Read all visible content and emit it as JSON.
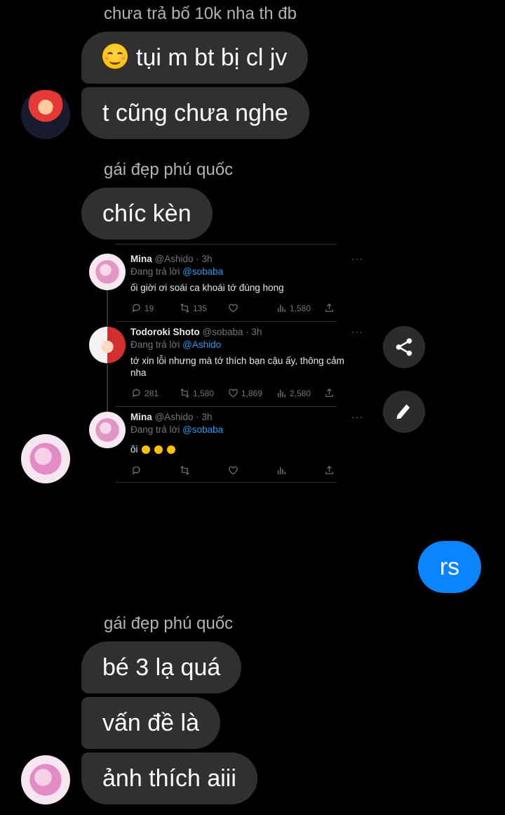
{
  "messages": {
    "group1": {
      "sender": "chưa trả bố 10k nha th đb",
      "bubble1": "tụi m bt bị cl jv",
      "bubble2": "t cũng chưa nghe"
    },
    "group2": {
      "sender": "gái đẹp phú quốc",
      "bubble1": "chíc kèn"
    },
    "outgoing": {
      "text": "rs"
    },
    "group3": {
      "sender": "gái đẹp phú quốc",
      "bubble1": "bé 3 lạ quá",
      "bubble2": "vấn đề là",
      "bubble3": "ảnh thích aiii"
    }
  },
  "tweets": [
    {
      "name": "Mina",
      "handle": "@Ashido · 3h",
      "reply_prefix": "Đang trả lời",
      "reply_to": "@sobaba",
      "text": "ối giời ơi soái ca khoái tớ đúng hong",
      "replies": "19",
      "retweets": "135",
      "likes": "",
      "views": "1,580"
    },
    {
      "name": "Todoroki Shoto",
      "handle": "@sobaba · 3h",
      "reply_prefix": "Đang trả lời",
      "reply_to": "@Ashido",
      "text": "tớ xin lỗi nhưng mà tớ thích bạn cậu ấy, thông cảm nha",
      "replies": "281",
      "retweets": "1,580",
      "likes": "1,869",
      "views": "2,580"
    },
    {
      "name": "Mina",
      "handle": "@Ashido · 3h",
      "reply_prefix": "Đang trả lời",
      "reply_to": "@sobaba",
      "text": "ôi",
      "replies": "",
      "retweets": "",
      "likes": "",
      "views": ""
    }
  ],
  "icons": {
    "share": "share-icon",
    "edit": "pencil-icon"
  },
  "colors": {
    "background": "#000000",
    "incoming_bubble": "#303030",
    "outgoing_bubble": "#0a84ff",
    "twitter_link": "#1d9bf0"
  }
}
